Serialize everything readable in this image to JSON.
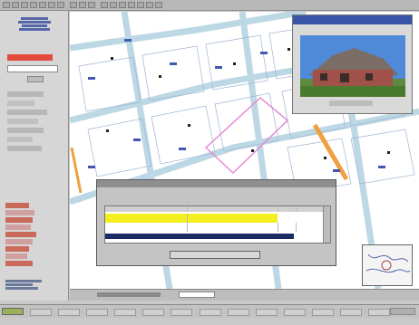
{
  "app": {
    "title": "",
    "status_text": ""
  },
  "toolbar": {
    "buttons": [
      "zoom-in",
      "zoom-out",
      "pan",
      "identify",
      "select",
      "measure",
      "print",
      "refresh",
      "layers",
      "help",
      "home",
      "search",
      "back",
      "forward",
      "info",
      "tools",
      "export"
    ]
  },
  "sidebar": {
    "header": "",
    "search_placeholder": "",
    "sections": [
      "",
      "",
      "",
      "",
      "",
      "",
      ""
    ],
    "legend_items": [
      "",
      "",
      "",
      "",
      "",
      "",
      "",
      "",
      ""
    ]
  },
  "photo_panel": {
    "caption": ""
  },
  "dialog": {
    "title": "",
    "description": "",
    "columns": [
      "",
      "",
      "",
      ""
    ],
    "rows": [
      {
        "values": [
          "",
          "",
          "",
          ""
        ],
        "highlight": "yellow"
      },
      {
        "values": [
          "",
          "",
          "",
          ""
        ],
        "highlight": "none"
      },
      {
        "values": [
          "",
          "",
          "",
          ""
        ],
        "highlight": "selected"
      }
    ],
    "button_label": ""
  },
  "colors": {
    "map_background": "#ffffff",
    "parcel_highlight": "#e58ad0",
    "street_highlight": "#f0a040",
    "yellow_row": "#f4ef1f",
    "selected_row": "#1c2a64",
    "photo_sky": "#3f7bcf",
    "photo_house": "#a0524a"
  }
}
